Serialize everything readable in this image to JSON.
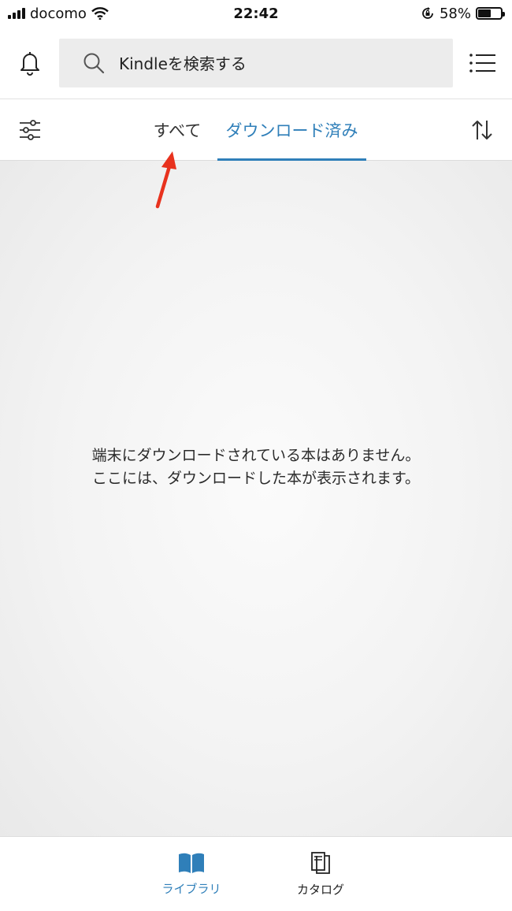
{
  "status_bar": {
    "carrier": "docomo",
    "time": "22:42",
    "battery_text": "58%",
    "battery_level": 0.58
  },
  "header": {
    "search_placeholder": "Kindleを検索する",
    "icons": {
      "bell": "bell-icon",
      "search": "search-icon",
      "menu": "list-menu-icon"
    }
  },
  "tabs": {
    "all_label": "すべて",
    "downloaded_label": "ダウンロード済み",
    "active_color": "#2f7fb9",
    "icons": {
      "filter": "filter-sliders-icon",
      "sort": "sort-arrows-icon"
    }
  },
  "main": {
    "empty_line1": "端末にダウンロードされている本はありません。",
    "empty_line2": "ここには、ダウンロードした本が表示されます。"
  },
  "annotation": {
    "arrow_color": "#e8321e"
  },
  "bottom_nav": {
    "library_label": "ライブラリ",
    "catalog_label": "カタログ",
    "icons": {
      "library": "open-book-icon",
      "catalog": "catalog-icon"
    }
  }
}
